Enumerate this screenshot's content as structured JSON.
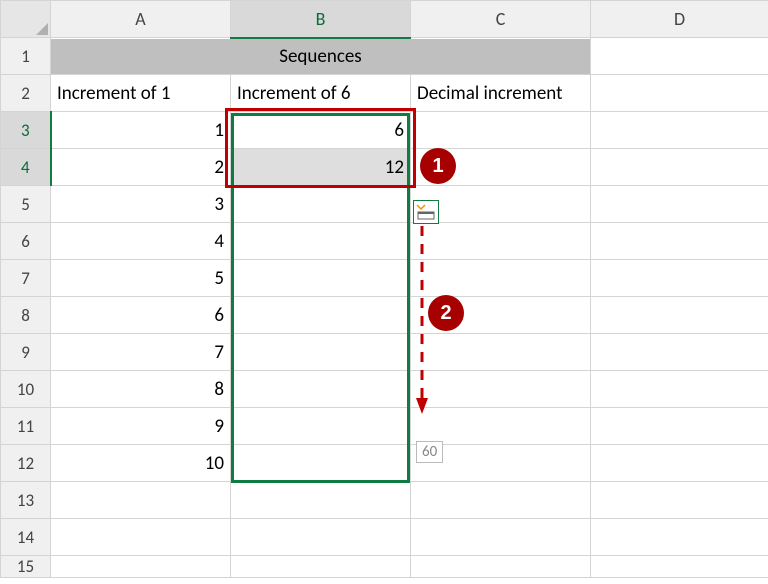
{
  "columns": [
    "A",
    "B",
    "C",
    "D"
  ],
  "rows": [
    "1",
    "2",
    "3",
    "4",
    "5",
    "6",
    "7",
    "8",
    "9",
    "10",
    "11",
    "12",
    "13",
    "14",
    "15"
  ],
  "merged_title": "Sequences",
  "headers": {
    "A": "Increment of 1",
    "B": "Increment of 6",
    "C": "Decimal increment"
  },
  "colA": [
    "1",
    "2",
    "3",
    "4",
    "5",
    "6",
    "7",
    "8",
    "9",
    "10"
  ],
  "colB": [
    "6",
    "12"
  ],
  "callouts": {
    "one": "1",
    "two": "2"
  },
  "autofill_hint": "60",
  "selected_column": "B",
  "selected_rows": [
    "3",
    "4"
  ]
}
